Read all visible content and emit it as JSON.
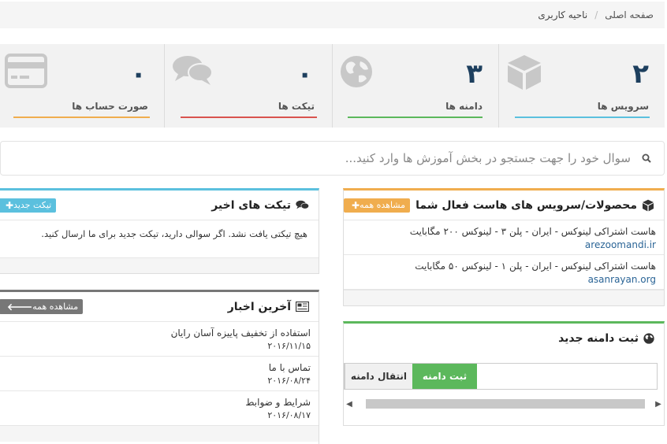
{
  "breadcrumb": {
    "home": "صفحه اصلی",
    "separator": "/",
    "active": "ناحیه کاربری"
  },
  "tiles": [
    {
      "number": "۲",
      "label": "سرویس ها",
      "icon": "cube-icon",
      "color": "#5bc0de"
    },
    {
      "number": "۳",
      "label": "دامنه ها",
      "icon": "globe-icon",
      "color": "#5cb85c"
    },
    {
      "number": "۰",
      "label": "تیکت ها",
      "icon": "comments-icon",
      "color": "#d9534f"
    },
    {
      "number": "۰",
      "label": "صورت حساب ها",
      "icon": "credit-card-icon",
      "color": "#f0ad4e"
    }
  ],
  "search": {
    "placeholder": "سوال خود را جهت جستجو در بخش آموزش ها وارد کنید..."
  },
  "products_panel": {
    "title": "محصولات/سرویس های هاست فعال شما",
    "badge": "مشاهده همه",
    "badge_color": "#f0ad4e",
    "items": [
      {
        "name": "هاست اشتراکی لینوکس - ایران - پلن ۳ - لینوکس ۲۰۰ مگابایت",
        "domain": "arezoomandi.ir"
      },
      {
        "name": "هاست اشتراکی لینوکس - ایران - پلن ۱ - لینوکس ۵۰ مگابایت",
        "domain": "asanrayan.org"
      }
    ]
  },
  "domain_panel": {
    "title": "ثبت دامنه جدید",
    "register_label": "ثبت دامنه",
    "transfer_label": "انتقال دامنه",
    "accent": "#5cb85c"
  },
  "tickets_panel": {
    "title": "تیکت های اخیر",
    "badge": "تیکت جدید",
    "badge_color": "#5bc0de",
    "empty_text": "هیچ تیکتی یافت نشد. اگر سوالی دارید، تیکت جدید برای ما ارسال کنید."
  },
  "news_panel": {
    "title": "آخرین اخبار",
    "badge": "مشاهده همه",
    "badge_color": "#777777",
    "items": [
      {
        "title": "استفاده از تخفیف پاییزه آسان رایان",
        "date": "۲۰۱۶/۱۱/۱۵"
      },
      {
        "title": "تماس با ما",
        "date": "۲۰۱۶/۰۸/۲۴"
      },
      {
        "title": "شرایط و ضوابط",
        "date": "۲۰۱۶/۰۸/۱۷"
      }
    ]
  }
}
